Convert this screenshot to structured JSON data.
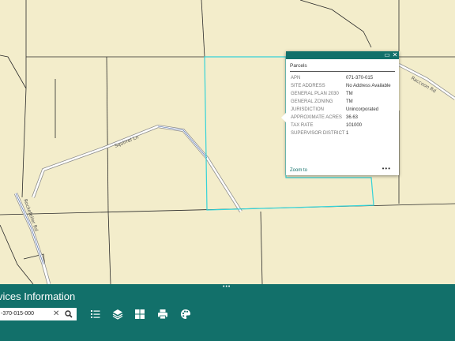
{
  "map": {
    "roads": [
      {
        "name": "Squirrel Ln"
      },
      {
        "name": "Rockefeller Rd"
      },
      {
        "name": "Raccoon Rd"
      }
    ],
    "colors": {
      "background": "#f3edcb",
      "parcel_line": "#2a2a2a",
      "selected_parcel": "#35d3d8",
      "road": "#ffffff",
      "road_edge": "#8a8a8a",
      "panel": "#12706a"
    }
  },
  "popup": {
    "title": "Parcels",
    "maximize_icon": "maximize-icon",
    "close_icon": "close-icon",
    "fields": [
      {
        "name": "APN",
        "value": "071-370-015"
      },
      {
        "name": "SITE ADDRESS",
        "value": "No Address Available"
      },
      {
        "name": "GENERAL PLAN 2030",
        "value": "TM"
      },
      {
        "name": "GENERAL ZONING",
        "value": "TM"
      },
      {
        "name": "JURISDICTION",
        "value": "Unincorporated"
      },
      {
        "name": "APPROXIMATE ACRES",
        "value": "36.63"
      },
      {
        "name": "TAX RATE",
        "value": "101000"
      },
      {
        "name": "SUPERVISOR DISTRICT",
        "value": "1"
      }
    ],
    "zoom_link": "Zoom to",
    "more": "•••"
  },
  "panel": {
    "handle": "•••",
    "title": "vices Information",
    "search_value": "-370-015-000",
    "clear_icon": "clear-icon",
    "search_icon": "search-icon",
    "tools": [
      "legend-list-icon",
      "layers-icon",
      "basemap-grid-icon",
      "print-icon",
      "palette-icon"
    ]
  }
}
